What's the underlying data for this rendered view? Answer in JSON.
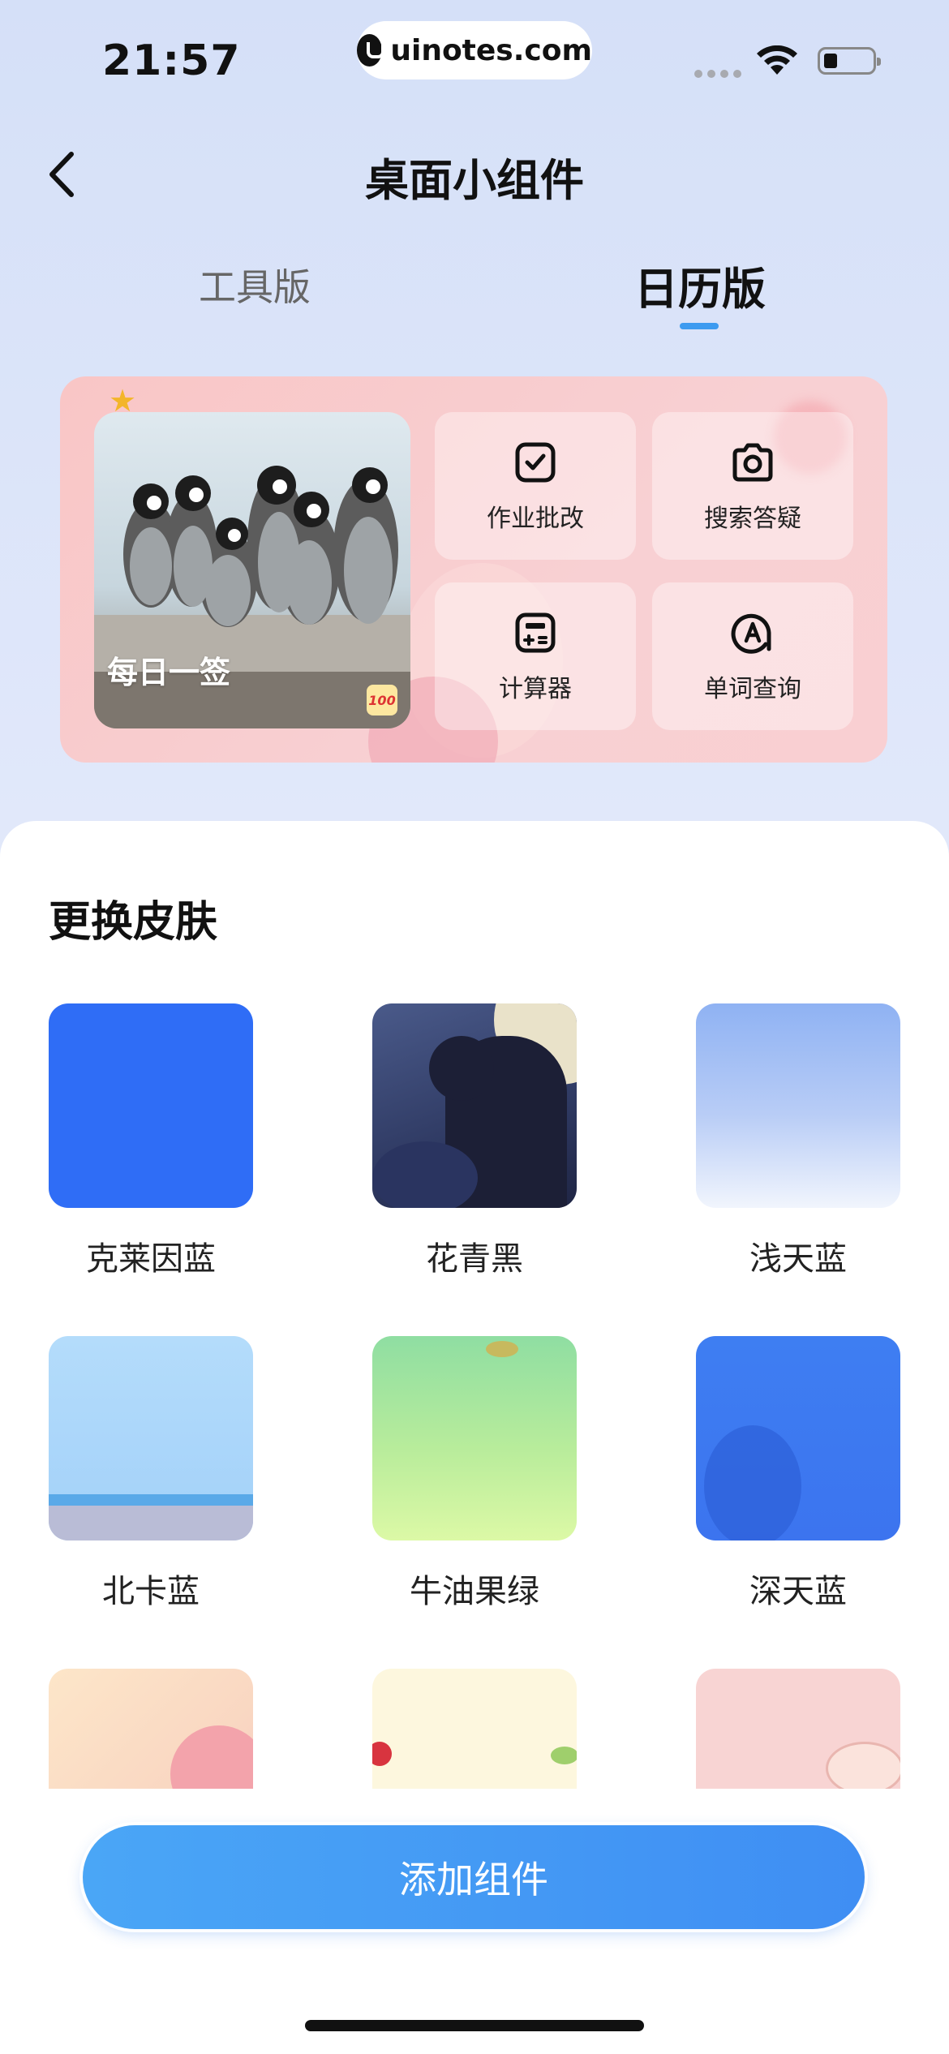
{
  "status_bar": {
    "time": "21:57",
    "url": "uinotes.com"
  },
  "header": {
    "title": "桌面小组件"
  },
  "tabs": [
    {
      "label": "工具版",
      "active": false
    },
    {
      "label": "日历版",
      "active": true
    }
  ],
  "widget": {
    "photo_caption": "每日一签",
    "badge": "100",
    "tools": [
      {
        "label": "作业批改",
        "icon": "check-square-icon"
      },
      {
        "label": "搜索答疑",
        "icon": "camera-icon"
      },
      {
        "label": "计算器",
        "icon": "calculator-icon"
      },
      {
        "label": "单词查询",
        "icon": "letter-a-search-icon"
      }
    ]
  },
  "skins": {
    "title": "更换皮肤",
    "items": [
      {
        "label": "克莱因蓝"
      },
      {
        "label": "花青黑"
      },
      {
        "label": "浅天蓝"
      },
      {
        "label": "北卡蓝"
      },
      {
        "label": "牛油果绿"
      },
      {
        "label": "深天蓝"
      },
      {
        "label": ""
      },
      {
        "label": ""
      },
      {
        "label": ""
      }
    ]
  },
  "actions": {
    "add_widget": "添加组件"
  },
  "colors": {
    "accent": "#3f8ef3",
    "klein_blue": "#2f6df6",
    "widget_bg": "#f9c6c6"
  }
}
